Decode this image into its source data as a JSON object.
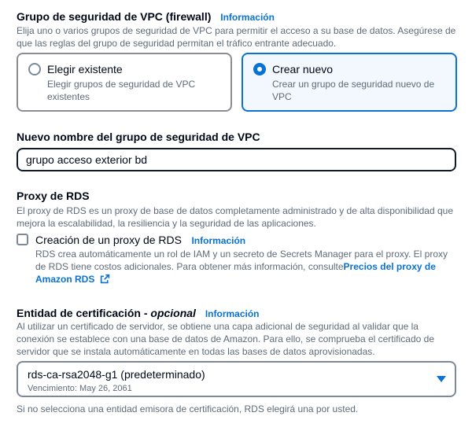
{
  "vpc_sg": {
    "title": "Grupo de seguridad de VPC (firewall)",
    "info": "Información",
    "description": "Elija uno o varios grupos de seguridad de VPC para permitir el acceso a su base de datos. Asegúrese de que las reglas del grupo de seguridad permitan el tráfico entrante adecuado.",
    "options": [
      {
        "label": "Elegir existente",
        "description": "Elegir grupos de seguridad de VPC existentes",
        "selected": false
      },
      {
        "label": "Crear nuevo",
        "description": "Crear un grupo de seguridad nuevo de VPC",
        "selected": true
      }
    ]
  },
  "new_sg_name": {
    "label": "Nuevo nombre del grupo de seguridad de VPC",
    "value": "grupo acceso exterior bd"
  },
  "rds_proxy": {
    "title": "Proxy de RDS",
    "description": "El proxy de RDS es un proxy de base de datos completamente administrado y de alta disponibilidad que mejora la escalabilidad, la resiliencia y la seguridad de las aplicaciones.",
    "checkbox_label": "Creación de un proxy de RDS",
    "checked": false,
    "info": "Información",
    "checkbox_description": "RDS crea automáticamente un rol de IAM y un secreto de Secrets Manager para el proxy. El proxy de RDS tiene costos adicionales. Para obtener más información, consulte",
    "pricing_link": "Precios del proxy de Amazon RDS",
    "external_icon": "external-link-icon"
  },
  "cert_authority": {
    "title": "Entidad de certificación",
    "optional": "opcional",
    "info": "Información",
    "description": "Al utilizar un certificado de servidor, se obtiene una capa adicional de seguridad al validar que la conexión se establece con una base de datos de Amazon. Para ello, se comprueba el certificado de servidor que se instala automáticamente en todas las bases de datos aprovisionadas.",
    "selected_value": "rds-ca-rsa2048-g1 (predeterminado)",
    "expiration": "Vencimiento: May 26, 2061",
    "footer_note": "Si no selecciona una entidad emisora de certificación, RDS elegirá una por usted."
  },
  "colors": {
    "accent": "#0972d3",
    "text": "#000716",
    "secondary_text": "#5f6b7a",
    "selected_tile_bg": "#f2f8fd"
  }
}
